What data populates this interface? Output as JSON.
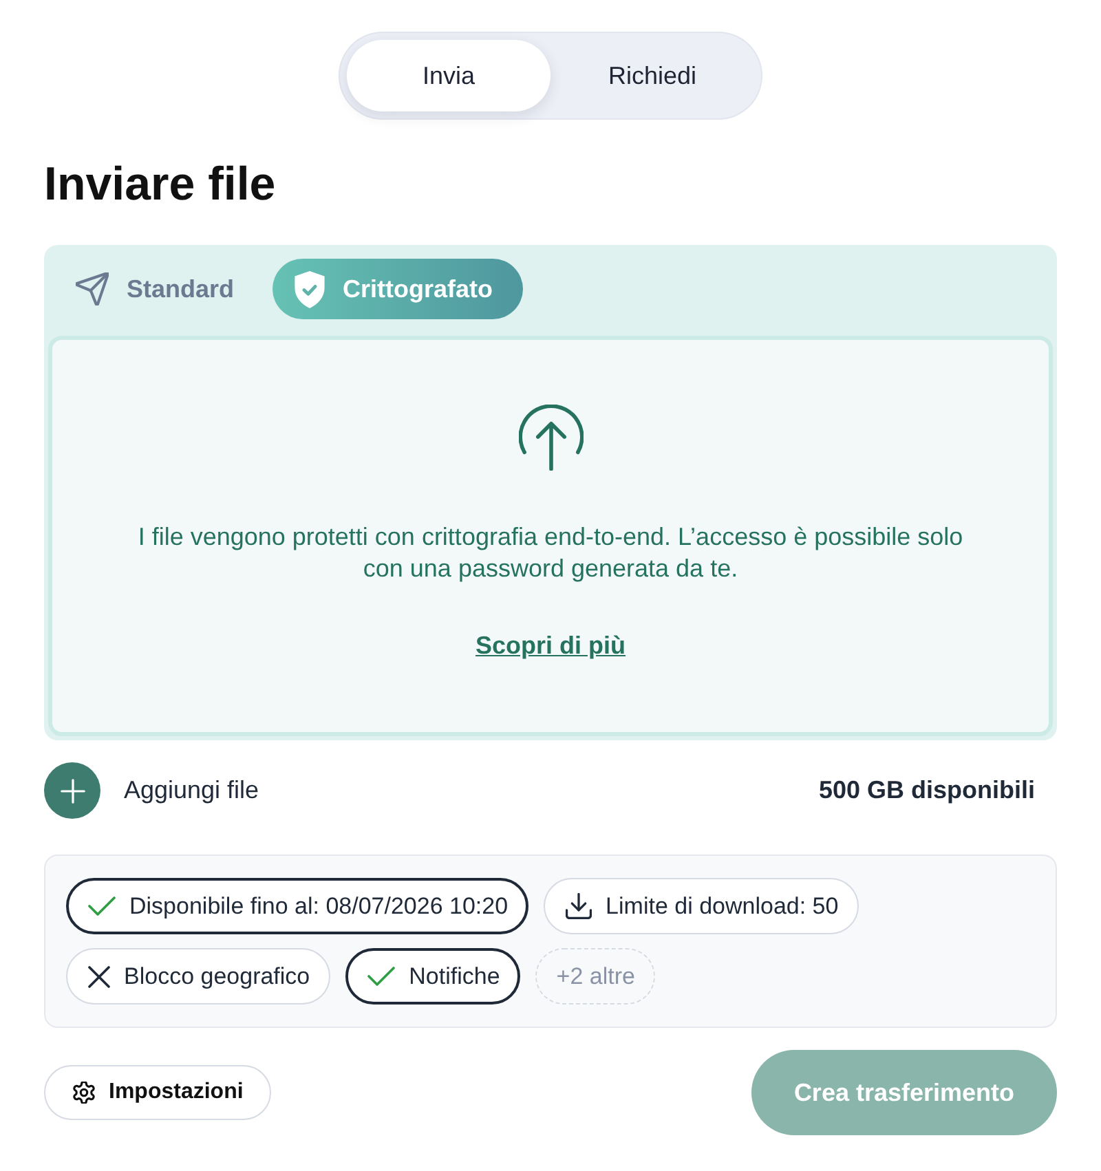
{
  "segmented": [
    {
      "label": "Invia",
      "selected": true
    },
    {
      "label": "Richiedi",
      "selected": false
    }
  ],
  "heading": "Inviare file",
  "modes": [
    {
      "kind": "standard",
      "label": "Standard",
      "selected": false
    },
    {
      "kind": "encrypted",
      "label": "Crittografato",
      "selected": true
    }
  ],
  "dropzone": {
    "text": "I file vengono protetti con crittografia end-to-end. L’accesso è possibile solo con una password generata da te.",
    "link": "Scopri di più"
  },
  "add_file": {
    "label": "Aggiungi file"
  },
  "storage": "500 GB disponibili",
  "options": [
    {
      "kind": "toggle",
      "label": "Disponibile fino al: 08/07/2026 10:20",
      "on": true
    },
    {
      "kind": "value",
      "label": "Limite di download: 50"
    },
    {
      "kind": "toggle",
      "label": "Blocco geografico",
      "on": false
    },
    {
      "kind": "toggle",
      "label": "Notifiche",
      "on": true
    },
    {
      "kind": "more",
      "label": "+2 altre"
    }
  ],
  "settings_button": "Impostazioni",
  "create_button": {
    "label": "Crea trasferimento",
    "disabled": true
  }
}
